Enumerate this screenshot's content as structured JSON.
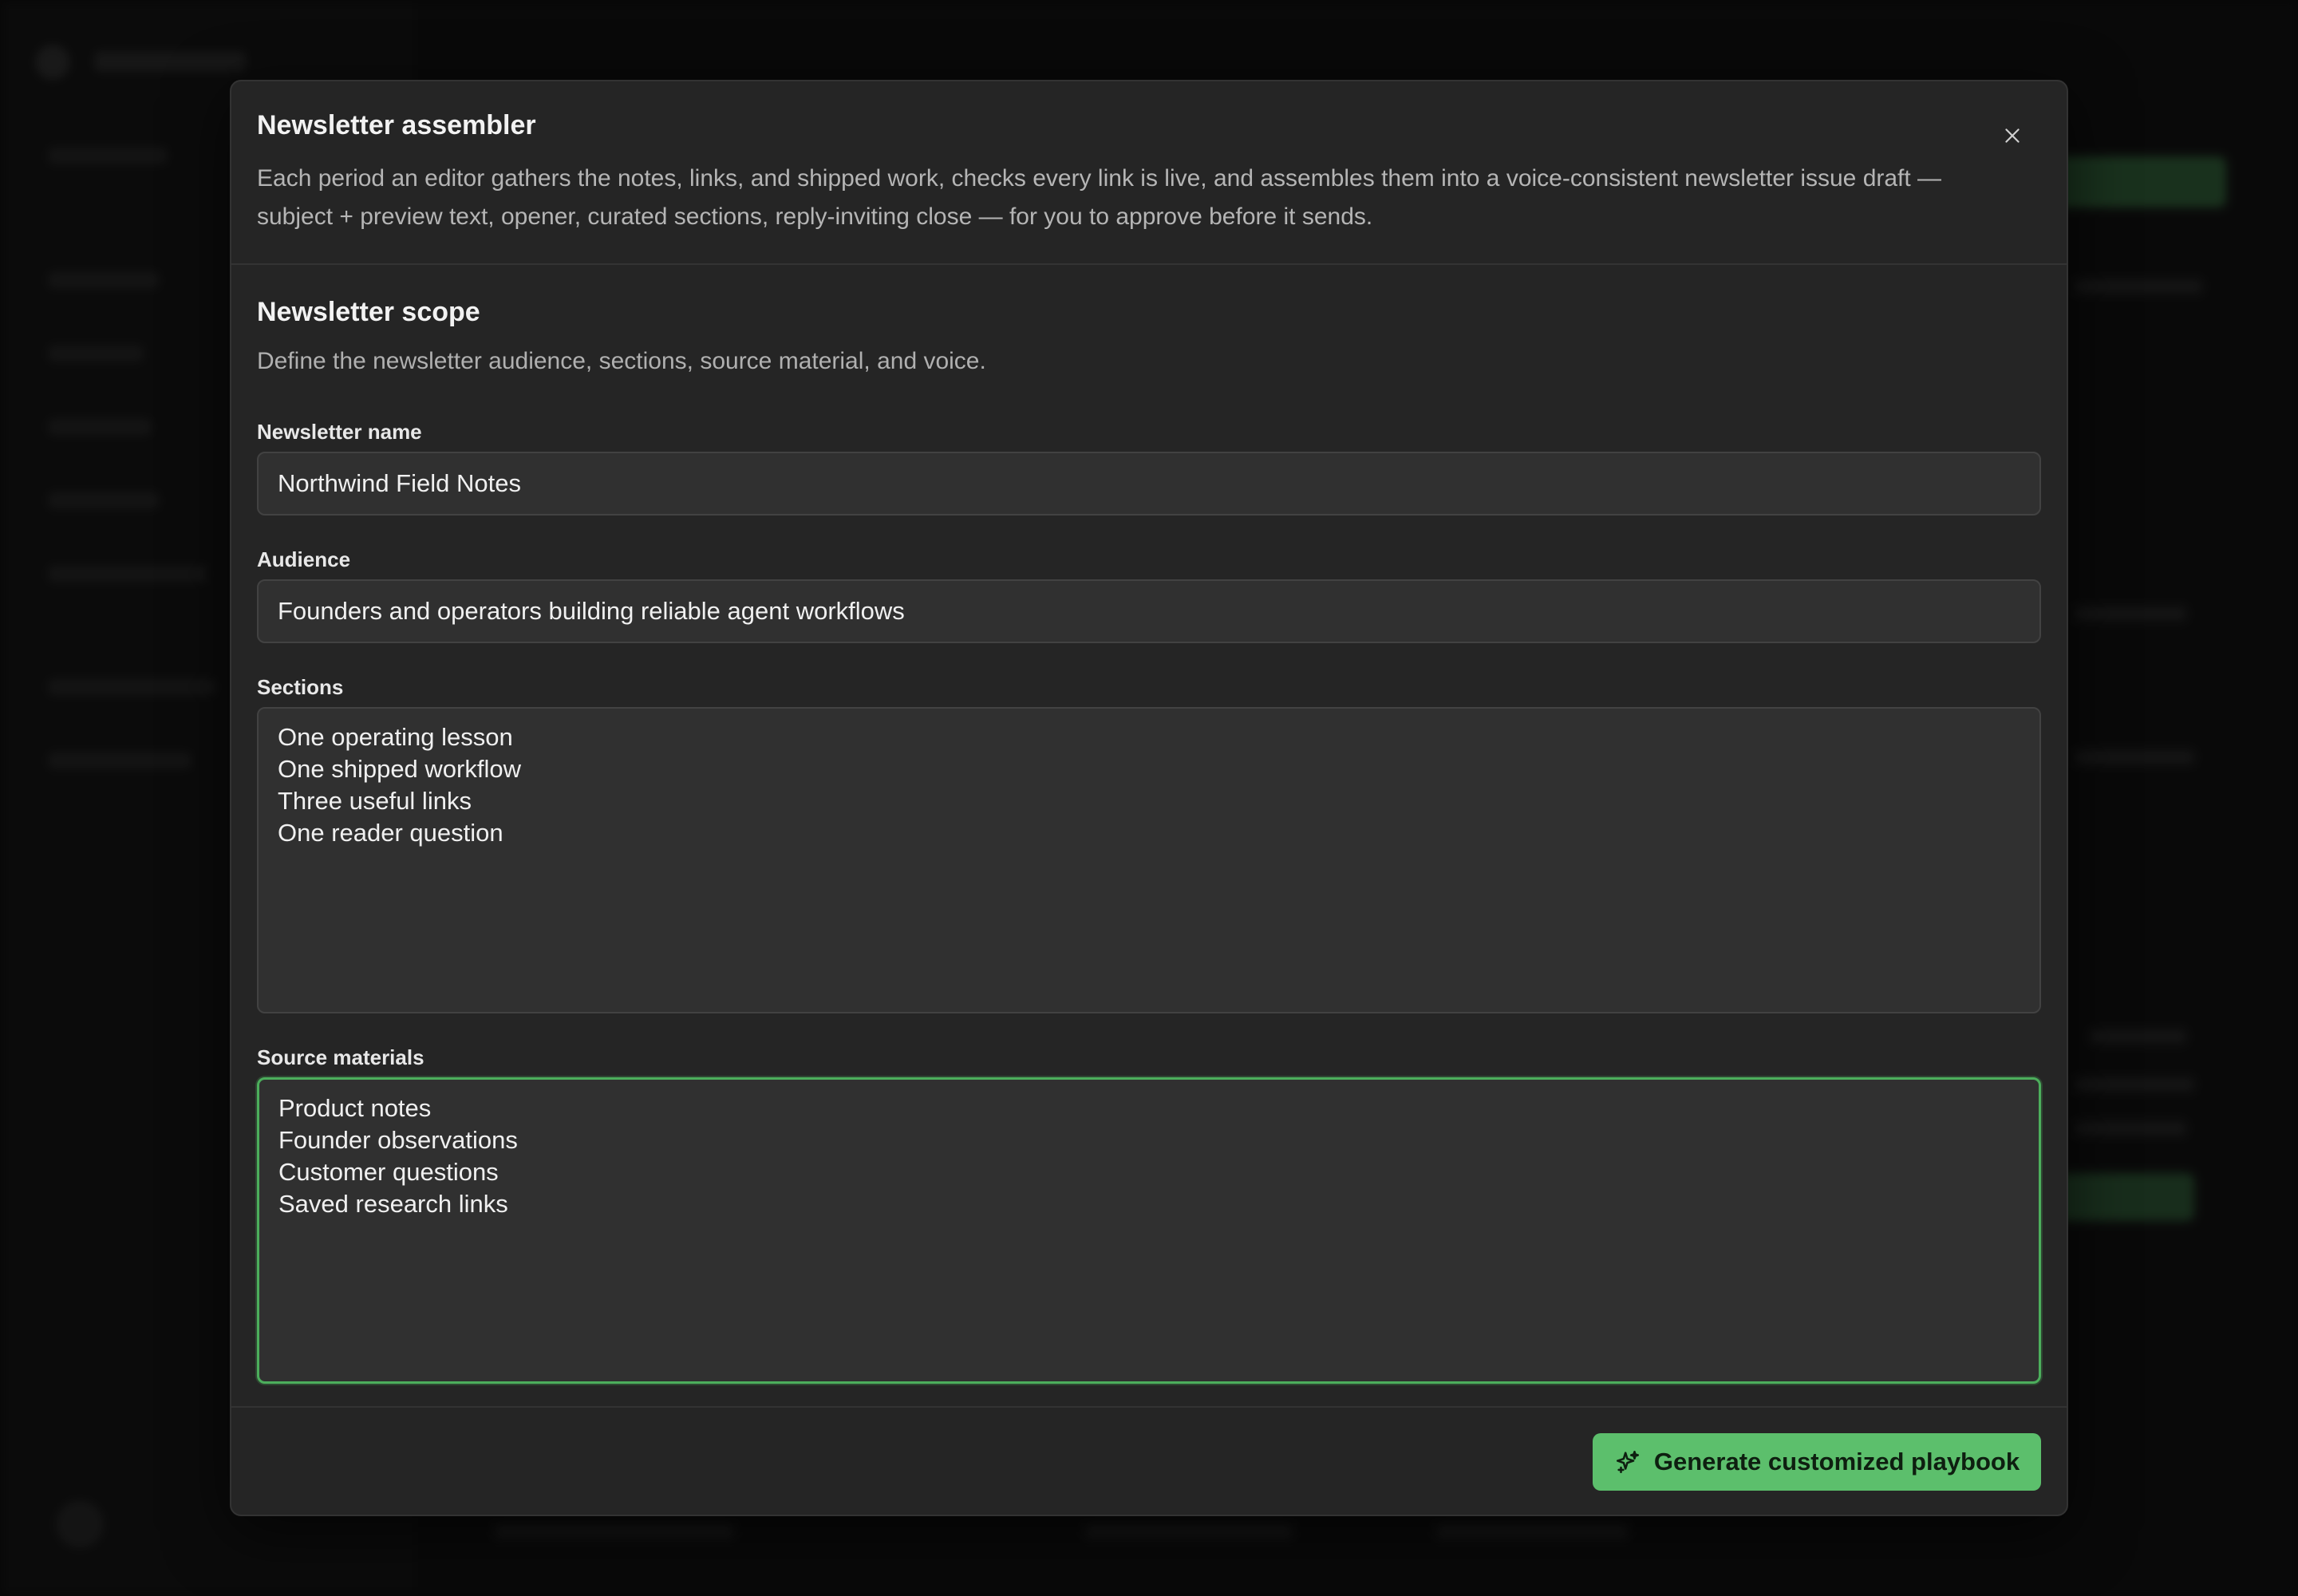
{
  "modal": {
    "title": "Newsletter assembler",
    "description": "Each period an editor gathers the notes, links, and shipped work, checks every link is live, and assembles them into a voice-consistent newsletter issue draft — subject + preview text, opener, curated sections, reply-inviting close — for you to approve before it sends.",
    "close_icon": "close-icon"
  },
  "scope": {
    "title": "Newsletter scope",
    "description": "Define the newsletter audience, sections, source material, and voice."
  },
  "fields": {
    "newsletter_name": {
      "label": "Newsletter name",
      "value": "Northwind Field Notes"
    },
    "audience": {
      "label": "Audience",
      "value": "Founders and operators building reliable agent workflows"
    },
    "sections": {
      "label": "Sections",
      "value": "One operating lesson\nOne shipped workflow\nThree useful links\nOne reader question"
    },
    "source_materials": {
      "label": "Source materials",
      "value": "Product notes\nFounder observations\nCustomer questions\nSaved research links"
    }
  },
  "footer": {
    "generate_label": "Generate customized playbook",
    "generate_icon": "sparkles-icon"
  },
  "colors": {
    "accent": "#5cbf6c",
    "focus_ring": "#4cae5c",
    "modal_bg": "#252525",
    "input_bg": "#303030"
  }
}
